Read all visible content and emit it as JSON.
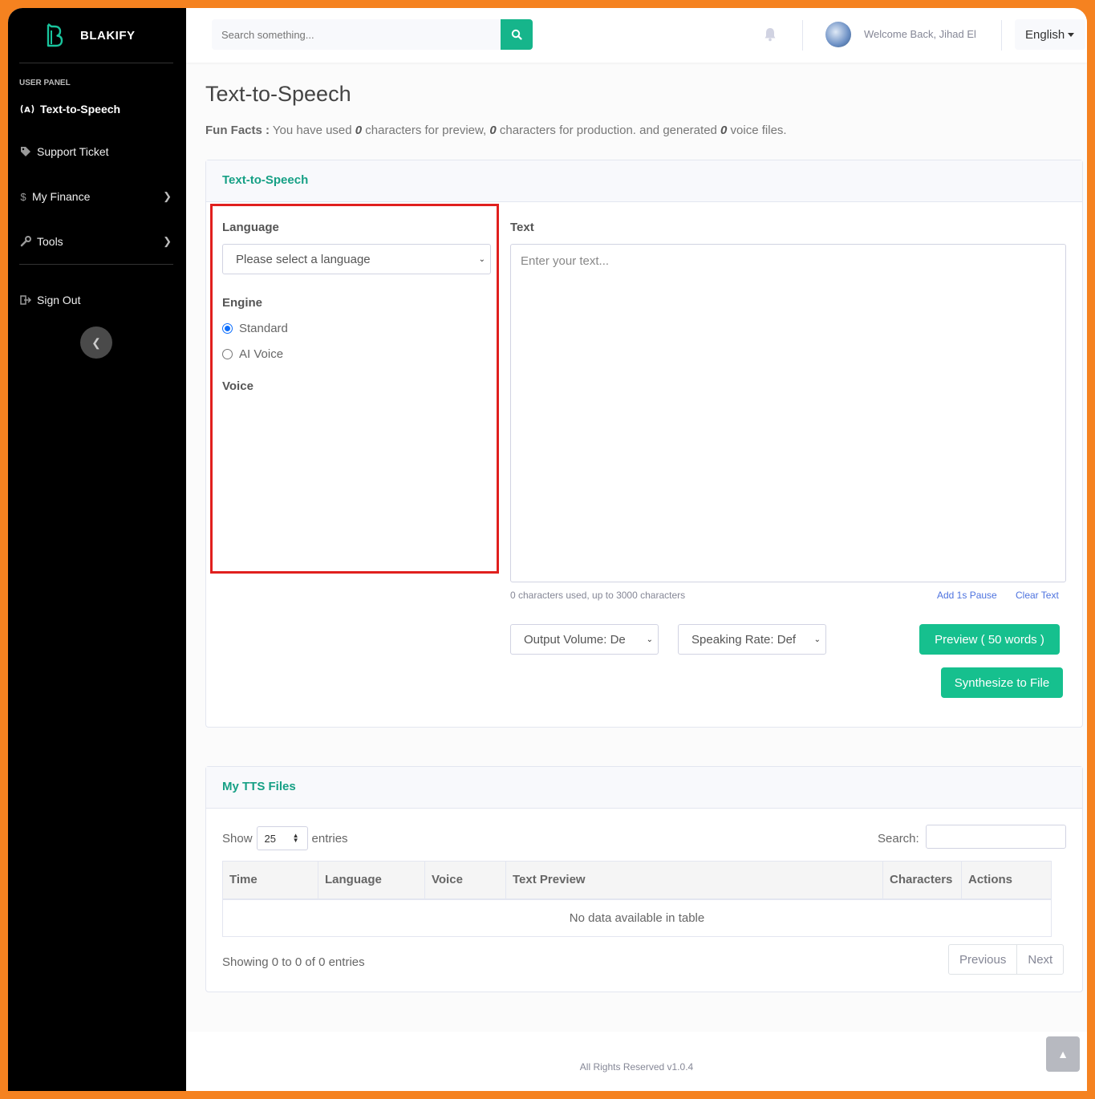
{
  "brand": {
    "name": "BLAKIFY"
  },
  "sidebar": {
    "heading": "USER PANEL",
    "items": [
      {
        "label": "Text-to-Speech"
      },
      {
        "label": "Support Ticket"
      },
      {
        "label": "My Finance"
      },
      {
        "label": "Tools"
      },
      {
        "label": "Sign Out"
      }
    ]
  },
  "topbar": {
    "search_placeholder": "Search something...",
    "welcome": "Welcome Back, Jihad El",
    "language": "English"
  },
  "page": {
    "title": "Text-to-Speech",
    "fun_facts_label": "Fun Facts :",
    "fun_facts_1": " You have used ",
    "preview_chars": "0",
    "fun_facts_2": " characters for preview, ",
    "production_chars": "0",
    "fun_facts_3": " characters for production. and generated ",
    "voice_files": "0",
    "fun_facts_4": " voice files."
  },
  "tts": {
    "card_title": "Text-to-Speech",
    "language_label": "Language",
    "language_select": "Please select a language",
    "engine_label": "Engine",
    "engine_standard": "Standard",
    "engine_ai": "AI Voice",
    "voice_label": "Voice",
    "text_label": "Text",
    "text_placeholder": "Enter your text...",
    "counter": "0 characters used, up to 3000 characters",
    "add_pause": "Add 1s Pause",
    "clear_text": "Clear Text",
    "output_volume": "Output Volume: De",
    "speaking_rate": "Speaking Rate: Def",
    "preview_btn": "Preview ( 50 words )",
    "synth_btn": "Synthesize to File"
  },
  "files": {
    "card_title": "My TTS Files",
    "show": "Show",
    "entries_value": "25",
    "entries": "entries",
    "search_label": "Search:",
    "columns": [
      "Time",
      "Language",
      "Voice",
      "Text Preview",
      "Characters",
      "Actions"
    ],
    "empty": "No data available in table",
    "showing": "Showing 0 to 0 of 0 entries",
    "prev": "Previous",
    "next": "Next"
  },
  "footer": {
    "text": "All Rights Reserved v1.0.4"
  }
}
